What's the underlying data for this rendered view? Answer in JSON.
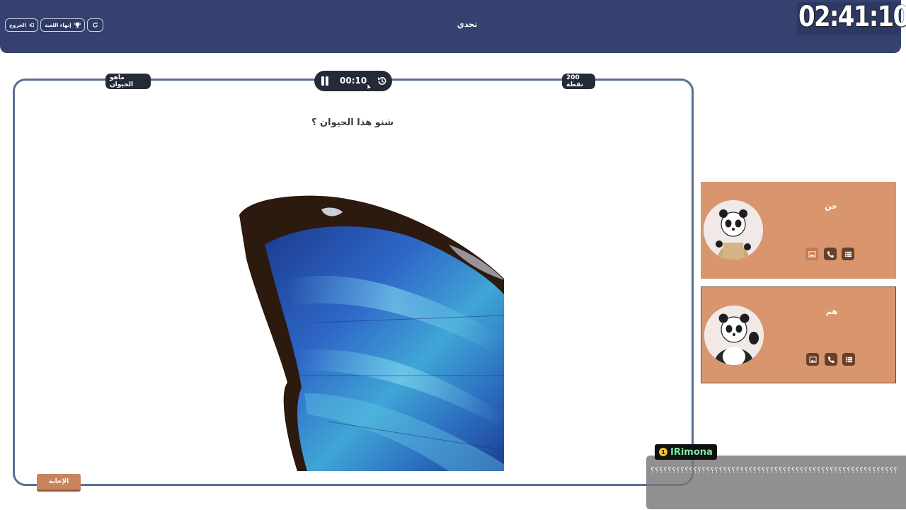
{
  "header": {
    "title": "تحدي",
    "buttons": {
      "exit_label": "الخروج",
      "end_game_label": "إنهاء اللعبة"
    }
  },
  "overlay_timer": "02:41:10",
  "board": {
    "category": "ماهو الحيوان",
    "points": "200 نقطة",
    "timer": "00:10",
    "question": "شنو هذا الحيوان ؟",
    "answer_label": "الإجابة"
  },
  "teams": [
    {
      "name": "حن"
    },
    {
      "name": "هم"
    }
  ],
  "chat": {
    "user_badge": "1",
    "username": "IRimona",
    "message": "؟؟؟؟؟؟؟؟؟؟؟؟؟؟؟؟؟؟؟؟؟؟؟؟؟؟؟؟؟؟؟؟؟؟؟؟؟؟؟؟؟؟؟؟؟؟؟؟؟؟؟؟؟؟؟؟؟؟؟؟؟؟؟؟؟؟؟؟؟؟؟؟؟؟؟؟؟؟؟؟؟؟؟؟؟؟؟؟؟؟؟؟؟؟؟؟؟؟؟؟؟؟؟؟؟؟؟؟؟؟؟؟؟؟؟؟؟؟؟؟؟؟؟؟؟؟؟؟"
  },
  "colors": {
    "header": "#354270",
    "board_border": "#5a6d97",
    "team_bg": "#d9956d",
    "answer_btn": "#c8845b",
    "chip_bg": "#252a38"
  }
}
